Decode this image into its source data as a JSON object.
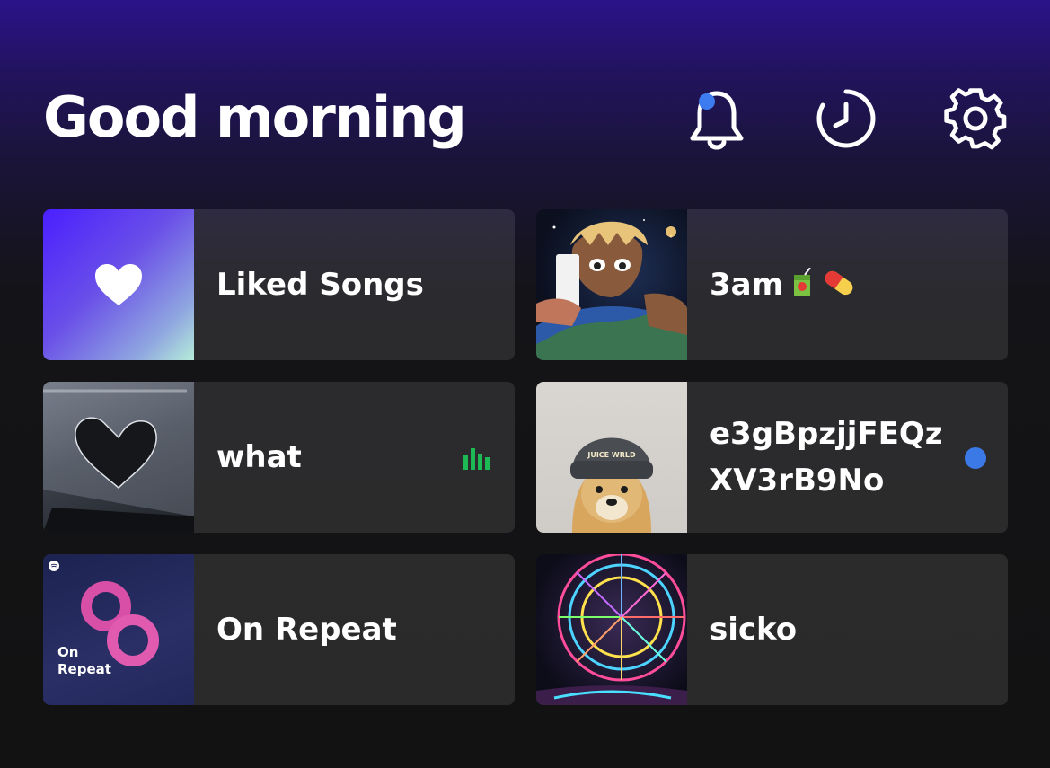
{
  "header": {
    "title": "Good morning",
    "icons": [
      "bell-icon",
      "history-icon",
      "settings-icon"
    ],
    "notification_dot_color": "#3d7bf0"
  },
  "tiles": [
    {
      "label": "Liked Songs",
      "art": "liked-songs-heart"
    },
    {
      "label": "3am",
      "art": "juice-wrld-earth-art",
      "emojis": [
        "juice-box-emoji",
        "pill-emoji"
      ]
    },
    {
      "label": "what",
      "art": "broken-heart-window",
      "playing": true,
      "playing_color": "#1db954"
    },
    {
      "label": "e3gBpzjjFEQzXV3rB9No",
      "art": "doge-beanie",
      "art_text": "JUICE WRLD",
      "unread_dot": true,
      "dot_color": "#3a79e6"
    },
    {
      "label": "On Repeat",
      "art": "on-repeat-cover",
      "art_text": "On Repeat"
    },
    {
      "label": "sicko",
      "art": "ferris-wheel"
    }
  ],
  "colors": {
    "background_top": "#2a138a",
    "background_bottom": "#121212",
    "tile_bg": "#2a2a2a"
  }
}
